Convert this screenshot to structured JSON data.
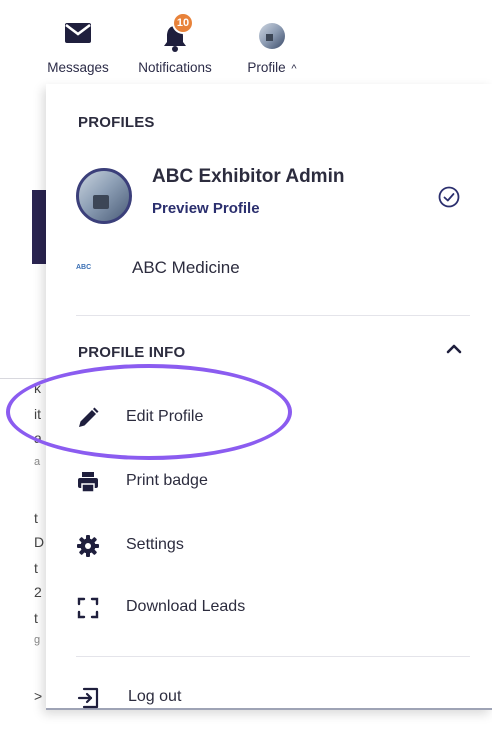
{
  "topnav": {
    "messages_label": "Messages",
    "notifications_label": "Notifications",
    "notifications_count": "10",
    "profile_label": "Profile",
    "profile_chevron": "^"
  },
  "background": {
    "fragments": [
      "k",
      "it",
      "a",
      "a",
      "t",
      "D",
      "t",
      "2",
      "t",
      "g",
      ">"
    ]
  },
  "dropdown": {
    "profiles_title": "PROFILES",
    "current_profile": {
      "name": "ABC Exhibitor Admin",
      "preview_label": "Preview Profile"
    },
    "organization": {
      "logo_text": "ABC",
      "name": "ABC Medicine"
    },
    "profile_info_title": "PROFILE INFO",
    "menu": [
      {
        "label": "Edit Profile",
        "icon": "pencil-icon"
      },
      {
        "label": "Print badge",
        "icon": "printer-icon"
      },
      {
        "label": "Settings",
        "icon": "gear-icon"
      },
      {
        "label": "Download Leads",
        "icon": "scan-icon"
      }
    ],
    "logout_label": "Log out"
  },
  "colors": {
    "accent_dark": "#2b2f6e",
    "badge": "#e8823a",
    "highlight_ellipse": "#8b5cf0",
    "text": "#2c2c3e"
  }
}
